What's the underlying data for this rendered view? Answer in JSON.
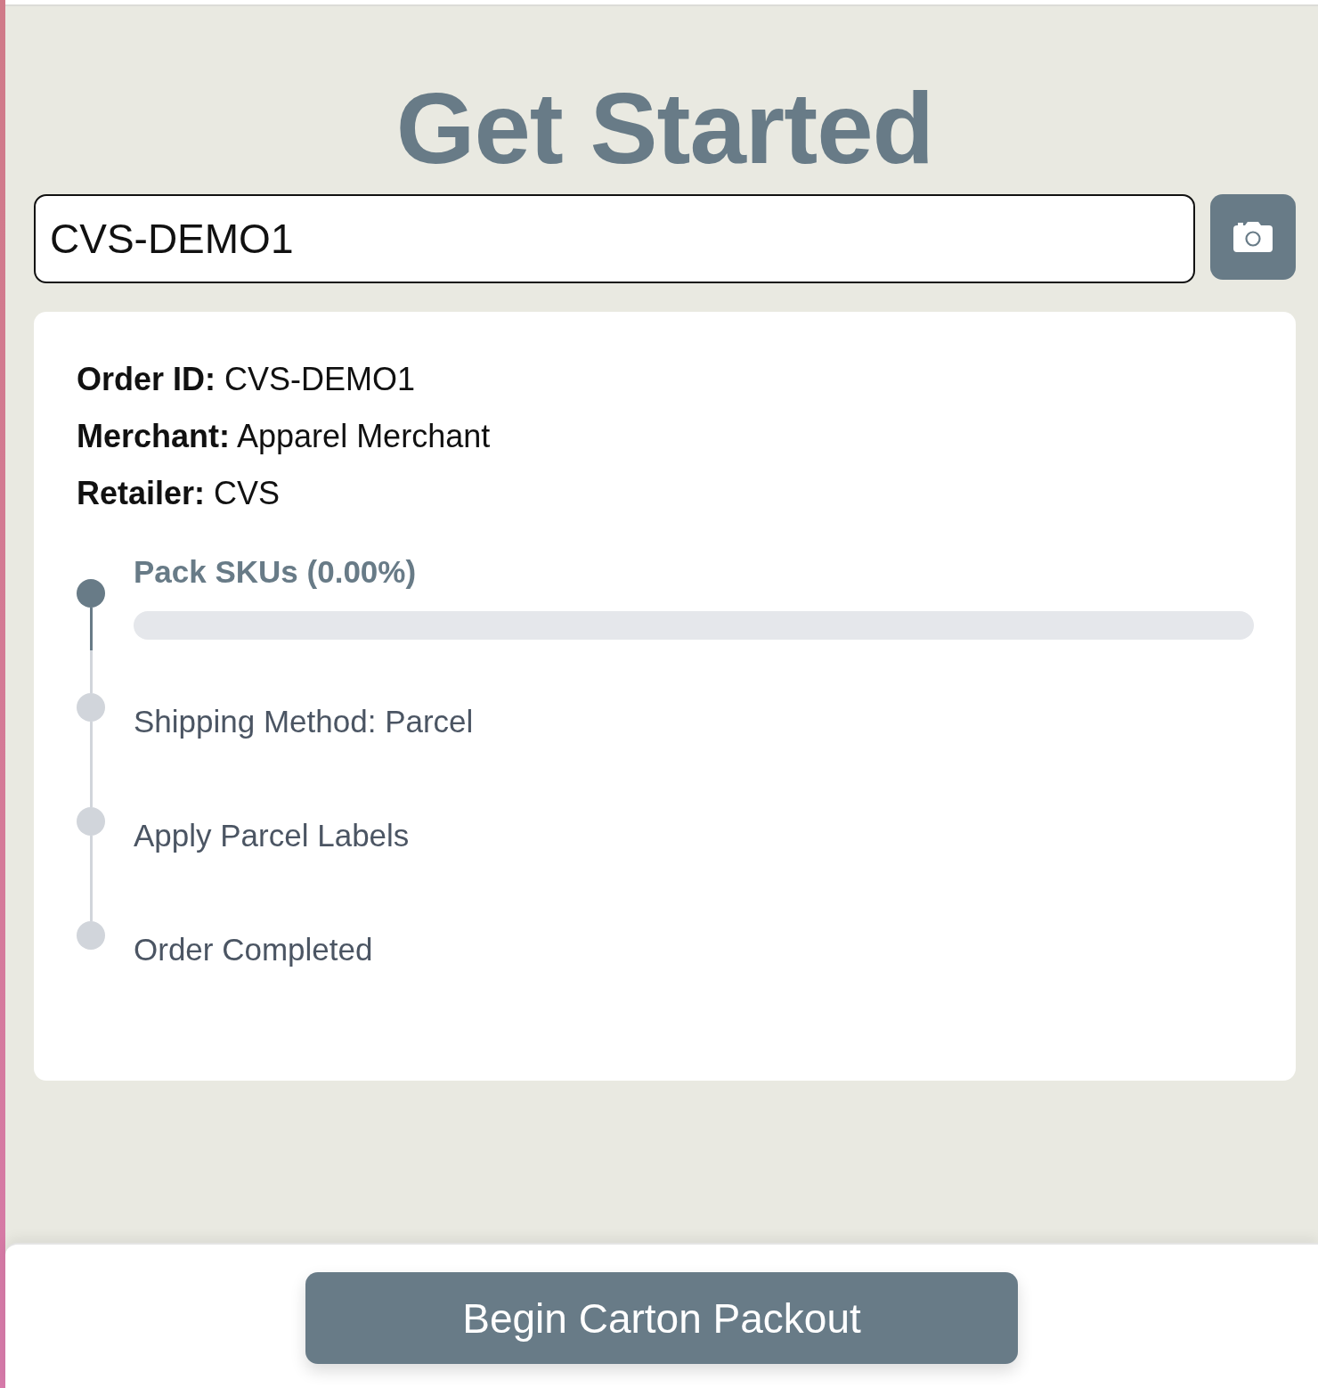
{
  "title": "Get Started",
  "order_search": {
    "value": "CVS-DEMO1"
  },
  "order_details": [
    {
      "label": "Order ID:",
      "value": "CVS-DEMO1"
    },
    {
      "label": "Merchant:",
      "value": "Apparel Merchant"
    },
    {
      "label": "Retailer:",
      "value": "CVS"
    }
  ],
  "steps": [
    {
      "kind": "progress",
      "label": "Pack SKUs (0.00%)",
      "active": true,
      "level": 0
    },
    {
      "kind": "plain",
      "label": "Shipping Method: Parcel",
      "active": false
    },
    {
      "kind": "plain",
      "label": "Apply Parcel Labels",
      "active": false
    },
    {
      "kind": "plain",
      "label": "Order Completed",
      "active": false
    }
  ],
  "footer": {
    "button": "Begin Carton Packout"
  }
}
